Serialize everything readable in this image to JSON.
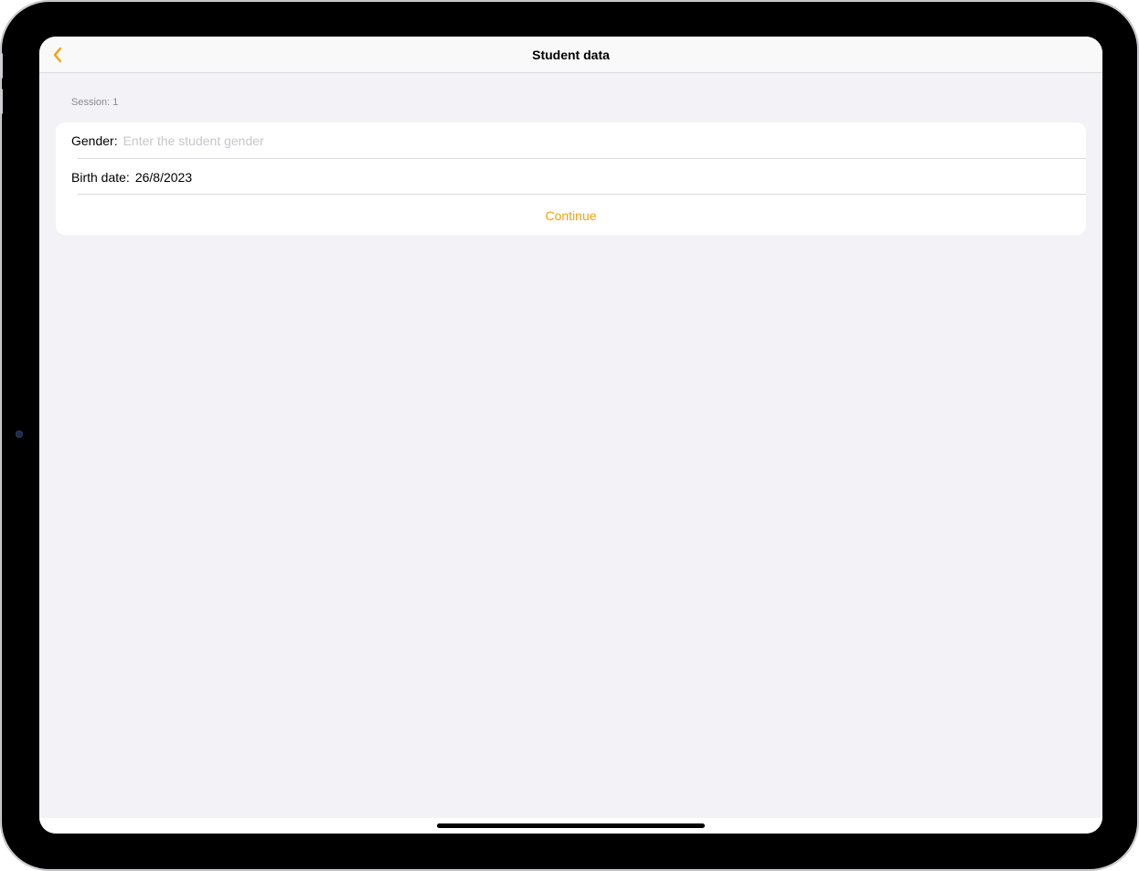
{
  "nav": {
    "title": "Student data",
    "back_icon": "chevron-left-icon"
  },
  "form": {
    "section_header": "Session: 1",
    "gender": {
      "label": "Gender:",
      "value": "",
      "placeholder": "Enter the student gender"
    },
    "birth_date": {
      "label": "Birth date:",
      "value": "26/8/2023"
    },
    "continue_label": "Continue"
  },
  "colors": {
    "accent": "#f5a00a",
    "background": "#f2f2f7",
    "card": "#ffffff",
    "placeholder": "#c7c7cc"
  }
}
